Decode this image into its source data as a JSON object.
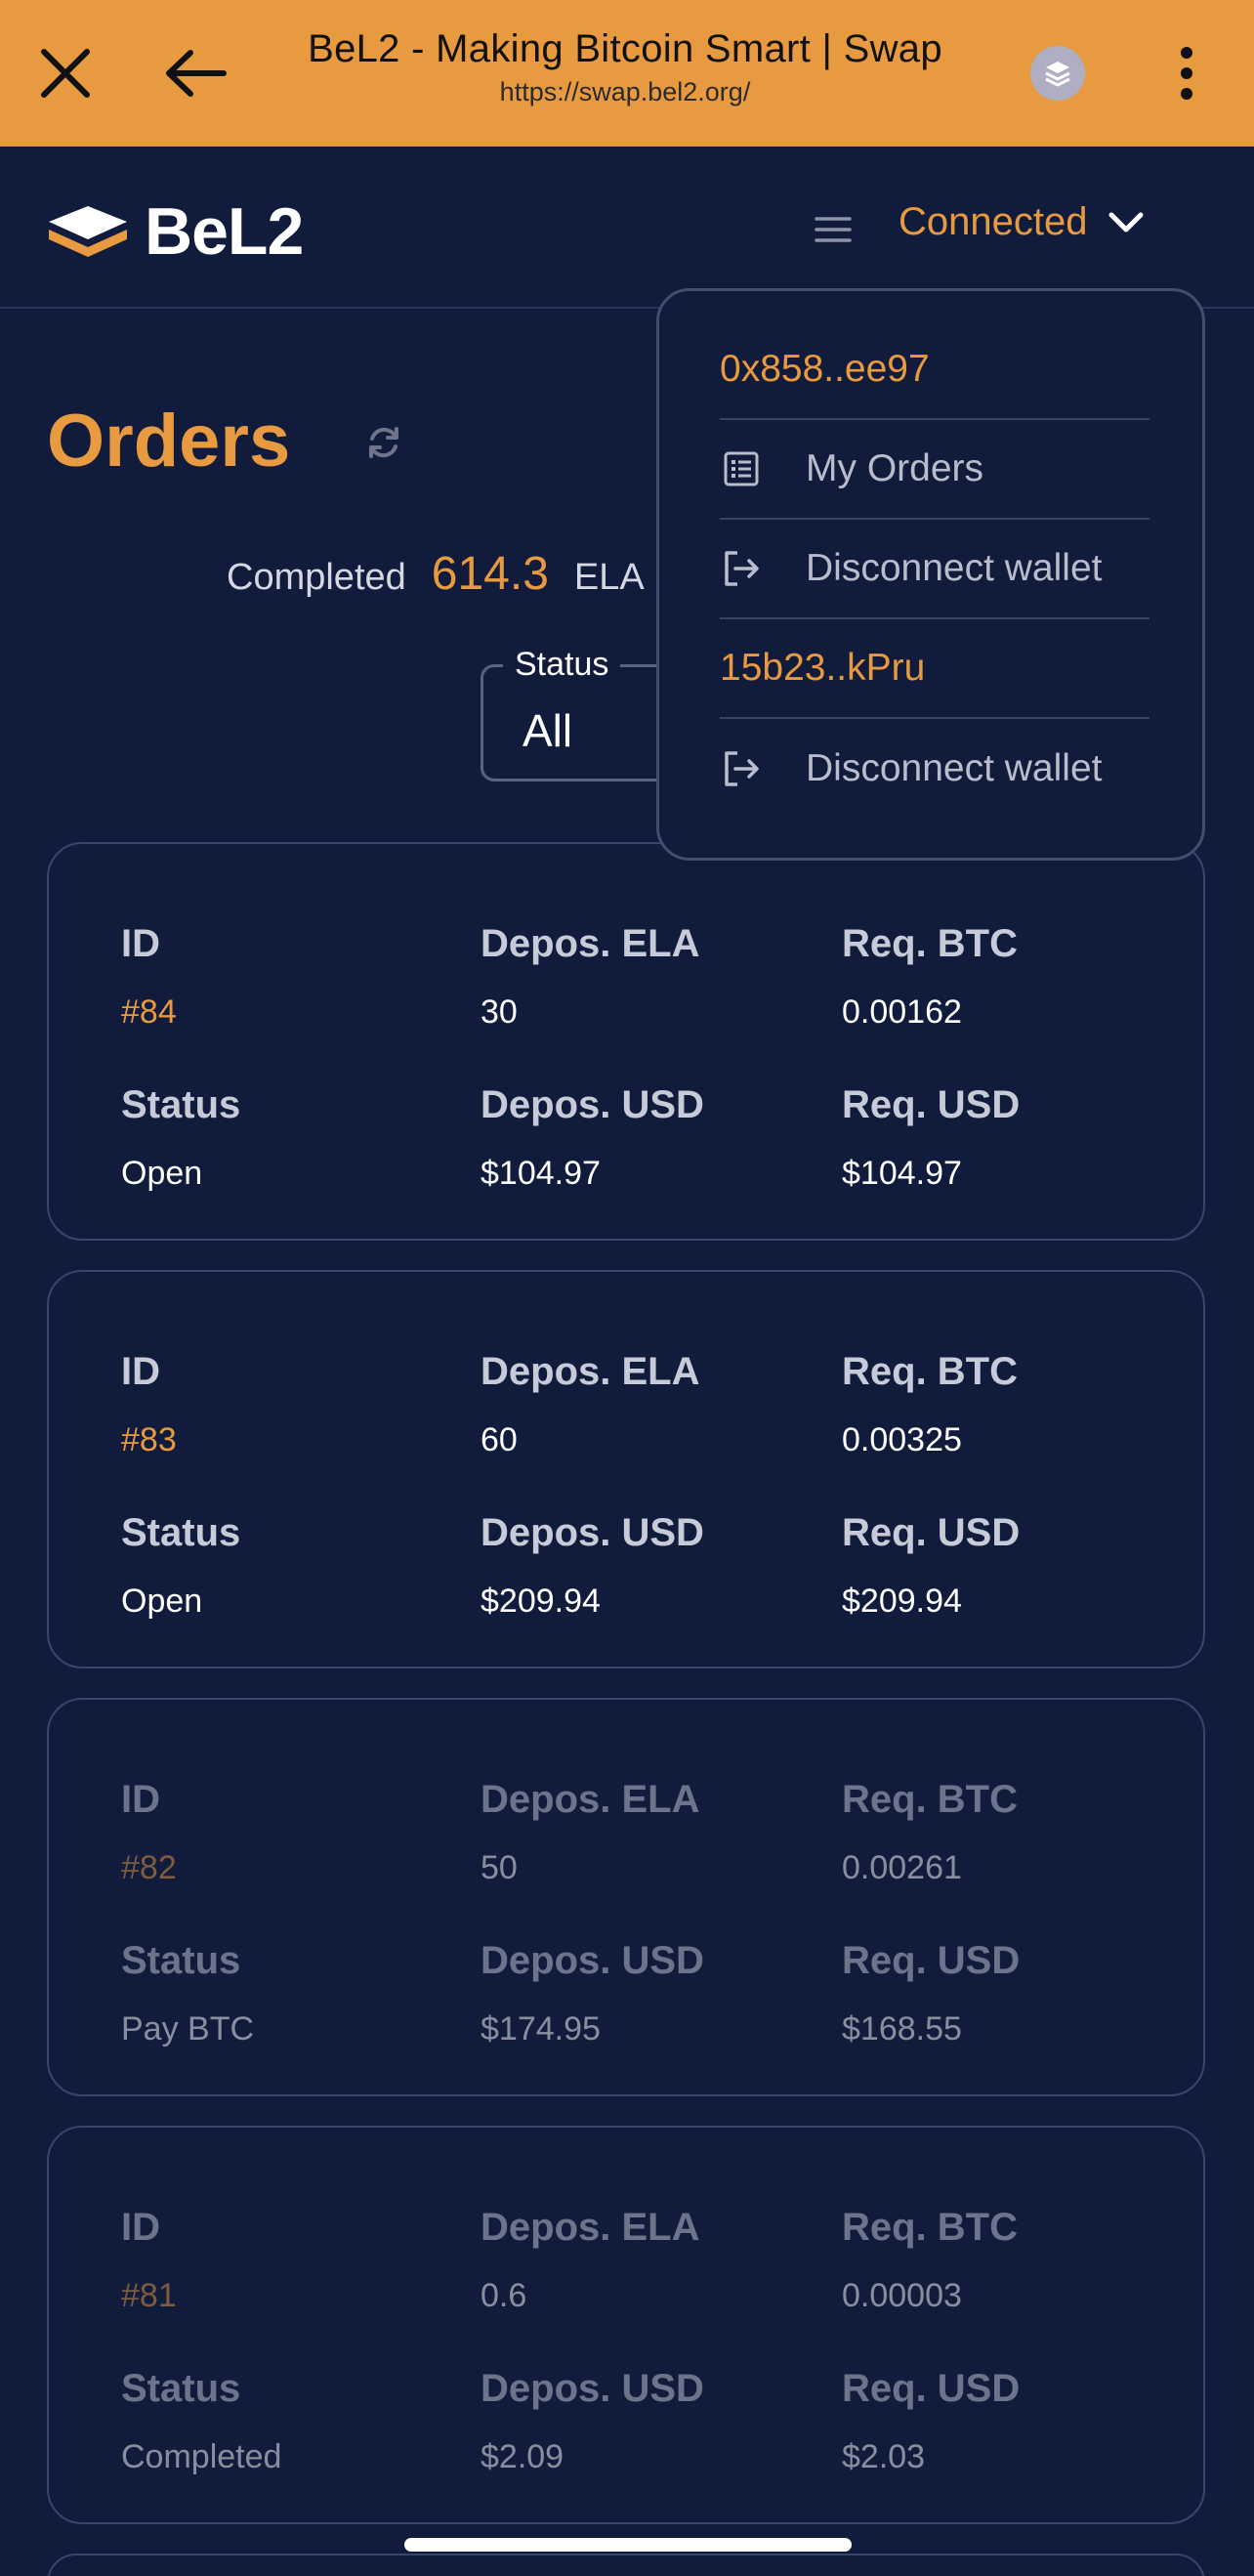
{
  "browser": {
    "title": "BeL2 - Making Bitcoin Smart | Swap",
    "url": "https://swap.bel2.org/"
  },
  "header": {
    "logo_text": "BeL2",
    "wallet_status": "Connected"
  },
  "orders": {
    "title": "Orders",
    "stats_label": "Completed",
    "stats_value": "614.3",
    "stats_unit": "ELA",
    "filter_label": "Status",
    "filter_value": "All"
  },
  "labels": {
    "id": "ID",
    "depos_ela": "Depos. ELA",
    "req_btc": "Req. BTC",
    "status": "Status",
    "depos_usd": "Depos. USD",
    "req_usd": "Req. USD"
  },
  "order_list": [
    {
      "id": "#84",
      "depos_ela": "30",
      "req_btc": "0.00162",
      "status": "Open",
      "depos_usd": "$104.97",
      "req_usd": "$104.97"
    },
    {
      "id": "#83",
      "depos_ela": "60",
      "req_btc": "0.00325",
      "status": "Open",
      "depos_usd": "$209.94",
      "req_usd": "$209.94"
    },
    {
      "id": "#82",
      "depos_ela": "50",
      "req_btc": "0.00261",
      "status": "Pay BTC",
      "depos_usd": "$174.95",
      "req_usd": "$168.55"
    },
    {
      "id": "#81",
      "depos_ela": "0.6",
      "req_btc": "0.00003",
      "status": "Completed",
      "depos_usd": "$2.09",
      "req_usd": "$2.03"
    }
  ],
  "wallet_menu": {
    "evm_address": "0x858..ee97",
    "my_orders": "My Orders",
    "disconnect_evm": "Disconnect wallet",
    "btc_address": "15b23..kPru",
    "disconnect_btc": "Disconnect wallet"
  },
  "colors": {
    "accent": "#e89a40",
    "background": "#111c3d",
    "browser_bar": "#e89a40"
  }
}
